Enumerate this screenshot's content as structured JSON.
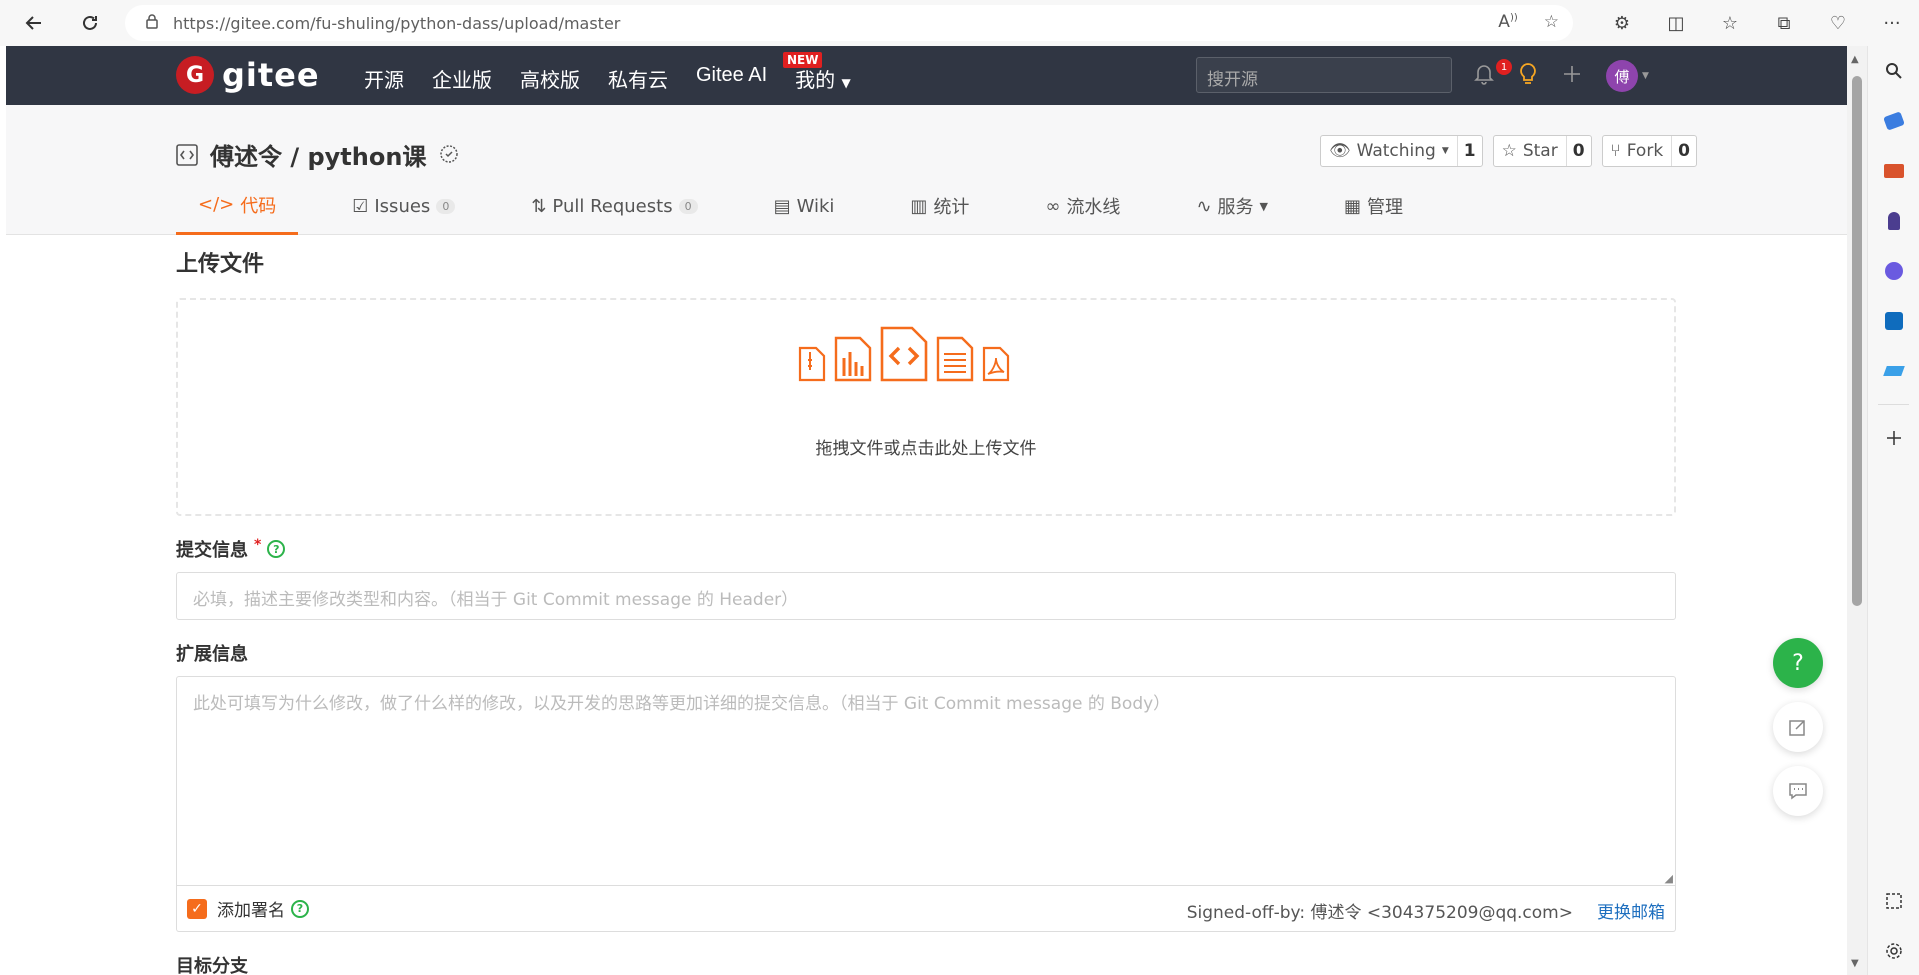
{
  "browser": {
    "url": "https://gitee.com/fu-shuling/python-dass/upload/master"
  },
  "header": {
    "logo": "gitee",
    "nav": [
      "开源",
      "企业版",
      "高校版",
      "私有云",
      "Gitee AI",
      "我的"
    ],
    "new_badge": "NEW",
    "search_placeholder": "搜开源",
    "notification_count": "1",
    "avatar_text": "傅"
  },
  "repo": {
    "title": "傅述令 / python课",
    "watching_label": "Watching",
    "watching_count": "1",
    "star_label": "Star",
    "star_count": "0",
    "fork_label": "Fork",
    "fork_count": "0",
    "tabs": [
      {
        "label": "代码",
        "count": ""
      },
      {
        "label": "Issues",
        "count": "0"
      },
      {
        "label": "Pull Requests",
        "count": "0"
      },
      {
        "label": "Wiki",
        "count": ""
      },
      {
        "label": "统计",
        "count": ""
      },
      {
        "label": "流水线",
        "count": ""
      },
      {
        "label": "服务",
        "count": ""
      },
      {
        "label": "管理",
        "count": ""
      }
    ]
  },
  "upload": {
    "title": "上传文件",
    "dropzone_text": "拖拽文件或点击此处上传文件",
    "commit_label": "提交信息",
    "commit_required": "*",
    "commit_placeholder": "必填，描述主要修改类型和内容。（相当于 Git Commit message 的 Header）",
    "ext_label": "扩展信息",
    "ext_placeholder": "此处可填写为什么修改，做了什么样的修改，以及开发的思路等更加详细的提交信息。（相当于 Git Commit message 的 Body）",
    "sign_label": "添加署名",
    "signed_off": "Signed-off-by: 傅述令 <304375209@qq.com>",
    "change_email": "更换邮箱",
    "target_branch": "目标分支"
  },
  "colors": {
    "accent": "#f56c1c",
    "header_bg": "#303643",
    "brand_red": "#c71d23",
    "help_green": "#2cb34a",
    "link": "#1e6fbf"
  }
}
